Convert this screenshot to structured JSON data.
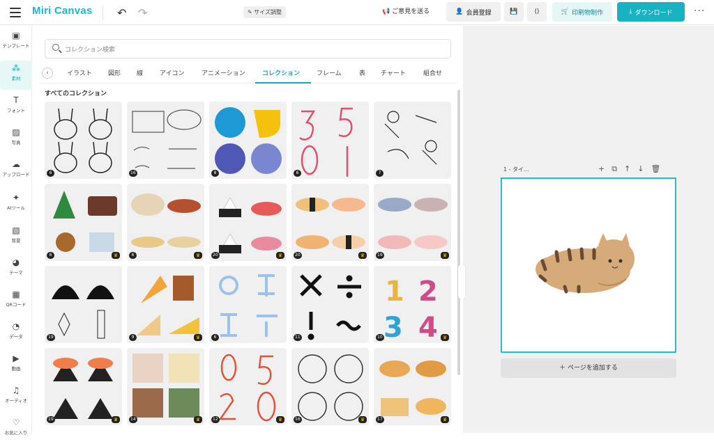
{
  "header": {
    "logo": "Miri Canvas",
    "size_adjust": "サイズ調整",
    "feedback": "ご意見を送る",
    "member": "会員登録",
    "print": "印刷物制作",
    "download": "ダウンロード"
  },
  "sidebar": {
    "items": [
      {
        "label": "テンプレート",
        "icon": "template-icon",
        "glyph": "▣"
      },
      {
        "label": "素材",
        "icon": "elements-icon",
        "glyph": "⁂"
      },
      {
        "label": "フォント",
        "icon": "text-icon",
        "glyph": "T"
      },
      {
        "label": "写真",
        "icon": "photo-icon",
        "glyph": "▨"
      },
      {
        "label": "アップロード",
        "icon": "upload-icon",
        "glyph": "☁"
      },
      {
        "label": "AIツール",
        "icon": "ai-icon",
        "glyph": "✦"
      },
      {
        "label": "背景",
        "icon": "background-icon",
        "glyph": "▧"
      },
      {
        "label": "テーマ",
        "icon": "theme-icon",
        "glyph": "◕"
      },
      {
        "label": "QRコード",
        "icon": "qr-icon",
        "glyph": "▦"
      },
      {
        "label": "データ",
        "icon": "data-icon",
        "glyph": "◔"
      },
      {
        "label": "動画",
        "icon": "video-icon",
        "glyph": "▶"
      },
      {
        "label": "オーディオ",
        "icon": "audio-icon",
        "glyph": "♫"
      },
      {
        "label": "お気に入り",
        "icon": "heart-icon",
        "glyph": "♡"
      }
    ],
    "active_index": 1
  },
  "panel": {
    "search_placeholder": "コレクション検索",
    "tabs": [
      "イラスト",
      "図形",
      "線",
      "アイコン",
      "アニメーション",
      "コレクション",
      "フレーム",
      "表",
      "チャート",
      "組合せ"
    ],
    "active_tab": "コレクション",
    "section_title": "すべてのコレクション",
    "cards": [
      {
        "name": "rabbit-faces",
        "count": "6",
        "premium": false
      },
      {
        "name": "speech-bubbles",
        "count": "16",
        "premium": false
      },
      {
        "name": "badge-shapes",
        "count": "8",
        "premium": false
      },
      {
        "name": "handwritten-numbers-pink",
        "count": "6",
        "premium": false
      },
      {
        "name": "people-illustrations",
        "count": "7",
        "premium": false
      },
      {
        "name": "christmas",
        "count": "6",
        "premium": true
      },
      {
        "name": "food-dishes",
        "count": "6",
        "premium": true
      },
      {
        "name": "onigiri-sushi",
        "count": "20",
        "premium": true
      },
      {
        "name": "sushi-nigiri",
        "count": "20",
        "premium": true
      },
      {
        "name": "sushi-faces",
        "count": "19",
        "premium": true
      },
      {
        "name": "camping",
        "count": "19",
        "premium": false
      },
      {
        "name": "snacks",
        "count": "9",
        "premium": true
      },
      {
        "name": "hangul-letters",
        "count": "6",
        "premium": false
      },
      {
        "name": "math-symbols",
        "count": "11",
        "premium": false
      },
      {
        "name": "3d-numbers",
        "count": "10",
        "premium": true
      },
      {
        "name": "salmon-onigiri",
        "count": "19",
        "premium": true
      },
      {
        "name": "memo-papers",
        "count": "14",
        "premium": true
      },
      {
        "name": "handwritten-numbers-red",
        "count": "12",
        "premium": true
      },
      {
        "name": "circled-numbers",
        "count": "16",
        "premium": true
      },
      {
        "name": "waffles",
        "count": "17",
        "premium": true
      }
    ]
  },
  "canvas": {
    "page_label": "1 - タイ...",
    "add_page": "ページを追加する"
  },
  "colors": {
    "accent": "#19b2c3",
    "badge": "#222222"
  }
}
